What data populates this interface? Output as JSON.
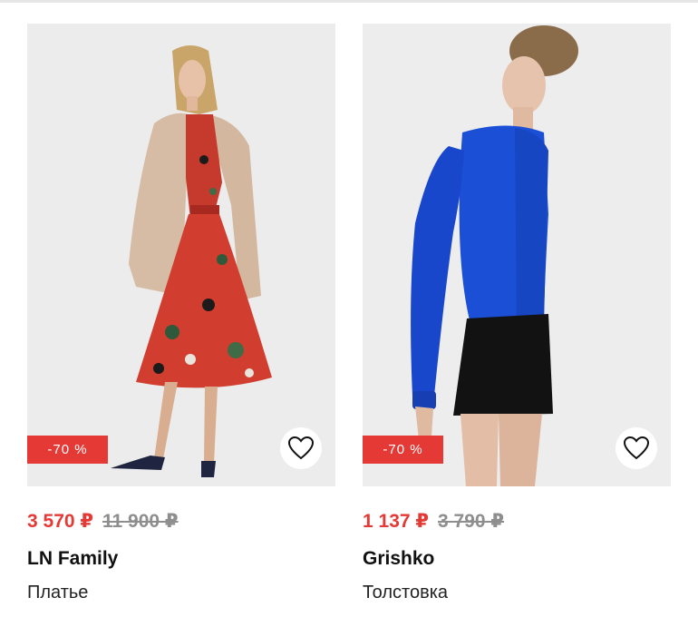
{
  "products": [
    {
      "discount": "-70 %",
      "price": "3 570 ₽",
      "old_price": "11 900 ₽",
      "brand": "LN Family",
      "category": "Платье",
      "favorite_icon": "heart-outline-icon"
    },
    {
      "discount": "-70 %",
      "price": "1 137 ₽",
      "old_price": "3 790 ₽",
      "brand": "Grishko",
      "category": "Толстовка",
      "favorite_icon": "heart-outline-icon"
    }
  ],
  "colors": {
    "accent": "#e53935",
    "old_price": "#8e8e8e",
    "photo_bg": "#ededed"
  }
}
